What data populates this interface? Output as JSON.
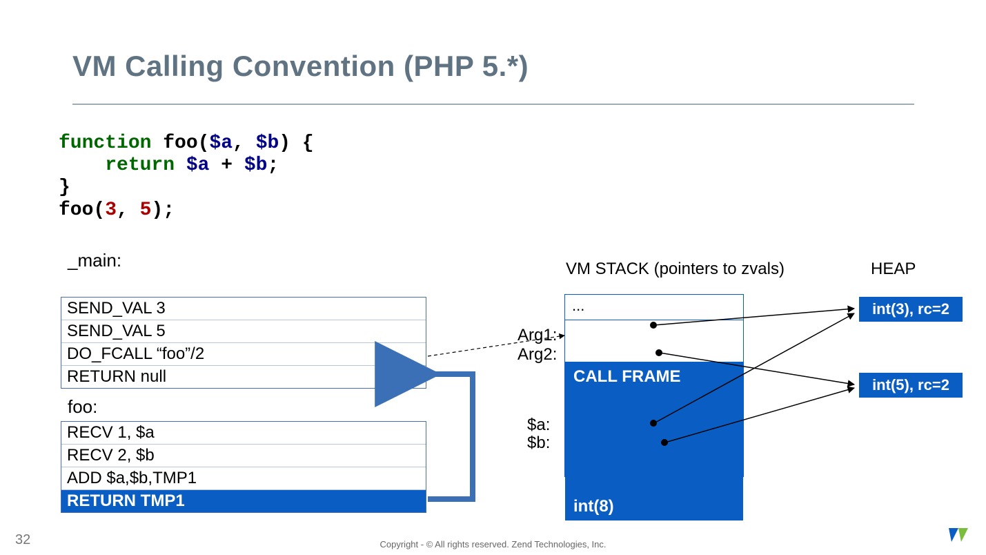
{
  "title": "VM Calling Convention (PHP 5.*)",
  "code": {
    "l1_kw": "function ",
    "l1_fn": "foo",
    "l1_open": "(",
    "l1_a": "$a",
    "l1_c1": ", ",
    "l1_b": "$b",
    "l1_close": ") {",
    "l2_indent": "    ",
    "l2_ret": "return ",
    "l2_a": "$a",
    "l2_plus": " + ",
    "l2_b": "$b",
    "l2_semi": ";",
    "l3": "}",
    "l4_fn": "foo",
    "l4_open": "(",
    "l4_n1": "3",
    "l4_c": ", ",
    "l4_n2": "5",
    "l4_close": ");"
  },
  "sections": {
    "main": "_main:",
    "foo": "foo:"
  },
  "main_ops": [
    "SEND_VAL 3",
    "SEND_VAL 5",
    "DO_FCALL  “foo”/2",
    "RETURN null"
  ],
  "foo_ops": [
    "RECV 1, $a",
    "RECV 2, $b",
    "ADD $a,$b,TMP1",
    "RETURN TMP1"
  ],
  "foo_active_index": 3,
  "right": {
    "vm_stack_label": "VM STACK (pointers to zvals)",
    "heap_label": "HEAP",
    "arg1": "Arg1:",
    "arg2": "Arg2:",
    "var_a": "$a:",
    "var_b": "$b:",
    "stack_top": "...",
    "call_frame": "CALL FRAME",
    "int8": "int(8)",
    "heap1": "int(3), rc=2",
    "heap2": "int(5), rc=2"
  },
  "footer": {
    "page": "32",
    "copyright": "Copyright - © All rights reserved. Zend Technologies, Inc."
  }
}
